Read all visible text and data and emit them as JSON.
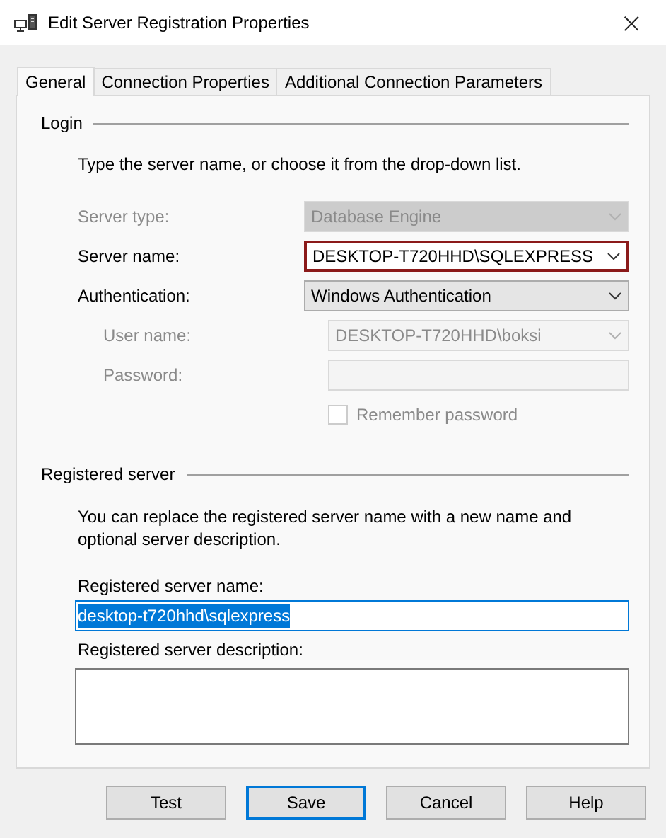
{
  "window": {
    "title": "Edit Server Registration Properties",
    "close": "×"
  },
  "tabs": [
    {
      "label": "General",
      "selected": true
    },
    {
      "label": "Connection Properties",
      "selected": false
    },
    {
      "label": "Additional Connection Parameters",
      "selected": false
    }
  ],
  "login": {
    "title": "Login",
    "instruction": "Type the server name, or choose it from the drop-down list.",
    "fields": [
      {
        "kind": "dropdown",
        "label": "Server type:",
        "value": "Database Engine",
        "disabled": true,
        "highlighted": false
      },
      {
        "kind": "combo",
        "label": "Server name:",
        "value": "DESKTOP-T720HHD\\SQLEXPRESS",
        "disabled": false,
        "highlighted": true
      },
      {
        "kind": "dropdown",
        "label": "Authentication:",
        "value": "Windows Authentication",
        "disabled": false,
        "highlighted": false,
        "children": [
          {
            "kind": "combo",
            "label": "User name:",
            "value": "DESKTOP-T720HHD\\boksi",
            "disabled": true,
            "highlighted": false
          },
          {
            "kind": "text",
            "label": "Password:",
            "disabled": true,
            "highlighted": false
          },
          {
            "kind": "checkbox",
            "label": "Remember password",
            "checked": false,
            "disabled": true
          }
        ]
      }
    ]
  },
  "registered": {
    "title": "Registered server",
    "description": "You can replace the registered server name with a new name and optional server description.",
    "name_label": "Registered server name:",
    "name_value": "desktop-t720hhd\\sqlexpress",
    "name_selected": true,
    "description_label": "Registered server description:"
  },
  "buttons": [
    {
      "label": "Test",
      "default": false
    },
    {
      "label": "Save",
      "default": true
    },
    {
      "label": "Cancel",
      "default": false
    },
    {
      "label": "Help",
      "default": false
    }
  ]
}
